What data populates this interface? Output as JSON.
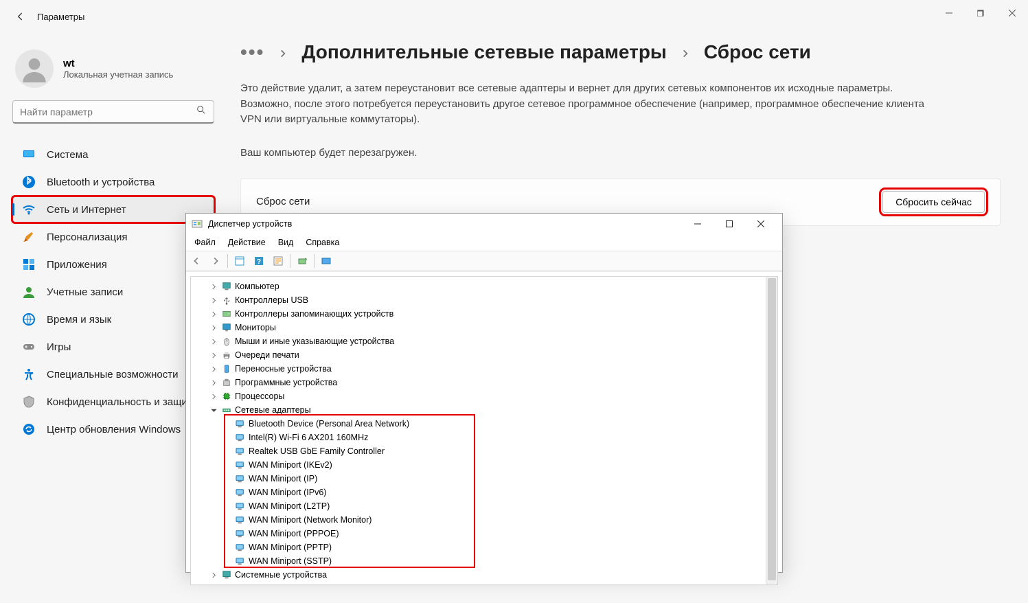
{
  "titlebar": {
    "title": "Параметры"
  },
  "profile": {
    "name": "wt",
    "subtitle": "Локальная учетная запись"
  },
  "search": {
    "placeholder": "Найти параметр"
  },
  "nav": [
    {
      "label": "Система",
      "icon": "system"
    },
    {
      "label": "Bluetooth и устройства",
      "icon": "bluetooth"
    },
    {
      "label": "Сеть и Интернет",
      "icon": "wifi",
      "active": true,
      "hl": true
    },
    {
      "label": "Персонализация",
      "icon": "brush"
    },
    {
      "label": "Приложения",
      "icon": "apps"
    },
    {
      "label": "Учетные записи",
      "icon": "user"
    },
    {
      "label": "Время и язык",
      "icon": "globe"
    },
    {
      "label": "Игры",
      "icon": "gamepad"
    },
    {
      "label": "Специальные возможности",
      "icon": "accessibility"
    },
    {
      "label": "Конфиденциальность и защита",
      "icon": "shield"
    },
    {
      "label": "Центр обновления Windows",
      "icon": "update"
    }
  ],
  "breadcrumb": {
    "ellipsis": "•••",
    "parent": "Дополнительные сетевые параметры",
    "current": "Сброс сети"
  },
  "desc1": "Это действие удалит, а затем переустановит все сетевые адаптеры и вернет для других сетевых компонентов их исходные параметры. Возможно, после этого потребуется переустановить другое сетевое программное обеспечение (например, программное обеспечение клиента VPN или виртуальные коммутаторы).",
  "desc2": "Ваш компьютер будет перезагружен.",
  "card": {
    "title": "Сброс сети",
    "button": "Сбросить сейчас"
  },
  "devmgr": {
    "title": "Диспетчер устройств",
    "menus": [
      "Файл",
      "Действие",
      "Вид",
      "Справка"
    ],
    "tree": [
      {
        "label": "Компьютер",
        "icon": "pc",
        "twist": "right",
        "indent": 1
      },
      {
        "label": "Контроллеры USB",
        "icon": "usb",
        "twist": "right",
        "indent": 1
      },
      {
        "label": "Контроллеры запоминающих устройств",
        "icon": "storage",
        "twist": "right",
        "indent": 1
      },
      {
        "label": "Мониторы",
        "icon": "monitor",
        "twist": "right",
        "indent": 1
      },
      {
        "label": "Мыши и иные указывающие устройства",
        "icon": "mouse",
        "twist": "right",
        "indent": 1
      },
      {
        "label": "Очереди печати",
        "icon": "printer",
        "twist": "right",
        "indent": 1
      },
      {
        "label": "Переносные устройства",
        "icon": "portable",
        "twist": "right",
        "indent": 1
      },
      {
        "label": "Программные устройства",
        "icon": "software",
        "twist": "right",
        "indent": 1
      },
      {
        "label": "Процессоры",
        "icon": "cpu",
        "twist": "right",
        "indent": 1
      },
      {
        "label": "Сетевые адаптеры",
        "icon": "net",
        "twist": "down",
        "indent": 1
      },
      {
        "label": "Bluetooth Device (Personal Area Network)",
        "icon": "adapter",
        "twist": "",
        "indent": 2
      },
      {
        "label": "Intel(R) Wi-Fi 6 AX201 160MHz",
        "icon": "adapter",
        "twist": "",
        "indent": 2
      },
      {
        "label": "Realtek USB GbE Family Controller",
        "icon": "adapter",
        "twist": "",
        "indent": 2
      },
      {
        "label": "WAN Miniport (IKEv2)",
        "icon": "adapter",
        "twist": "",
        "indent": 2
      },
      {
        "label": "WAN Miniport (IP)",
        "icon": "adapter",
        "twist": "",
        "indent": 2
      },
      {
        "label": "WAN Miniport (IPv6)",
        "icon": "adapter",
        "twist": "",
        "indent": 2
      },
      {
        "label": "WAN Miniport (L2TP)",
        "icon": "adapter",
        "twist": "",
        "indent": 2
      },
      {
        "label": "WAN Miniport (Network Monitor)",
        "icon": "adapter",
        "twist": "",
        "indent": 2
      },
      {
        "label": "WAN Miniport (PPPOE)",
        "icon": "adapter",
        "twist": "",
        "indent": 2
      },
      {
        "label": "WAN Miniport (PPTP)",
        "icon": "adapter",
        "twist": "",
        "indent": 2
      },
      {
        "label": "WAN Miniport (SSTP)",
        "icon": "adapter",
        "twist": "",
        "indent": 2
      },
      {
        "label": "Системные устройства",
        "icon": "system",
        "twist": "right",
        "indent": 1
      }
    ]
  }
}
